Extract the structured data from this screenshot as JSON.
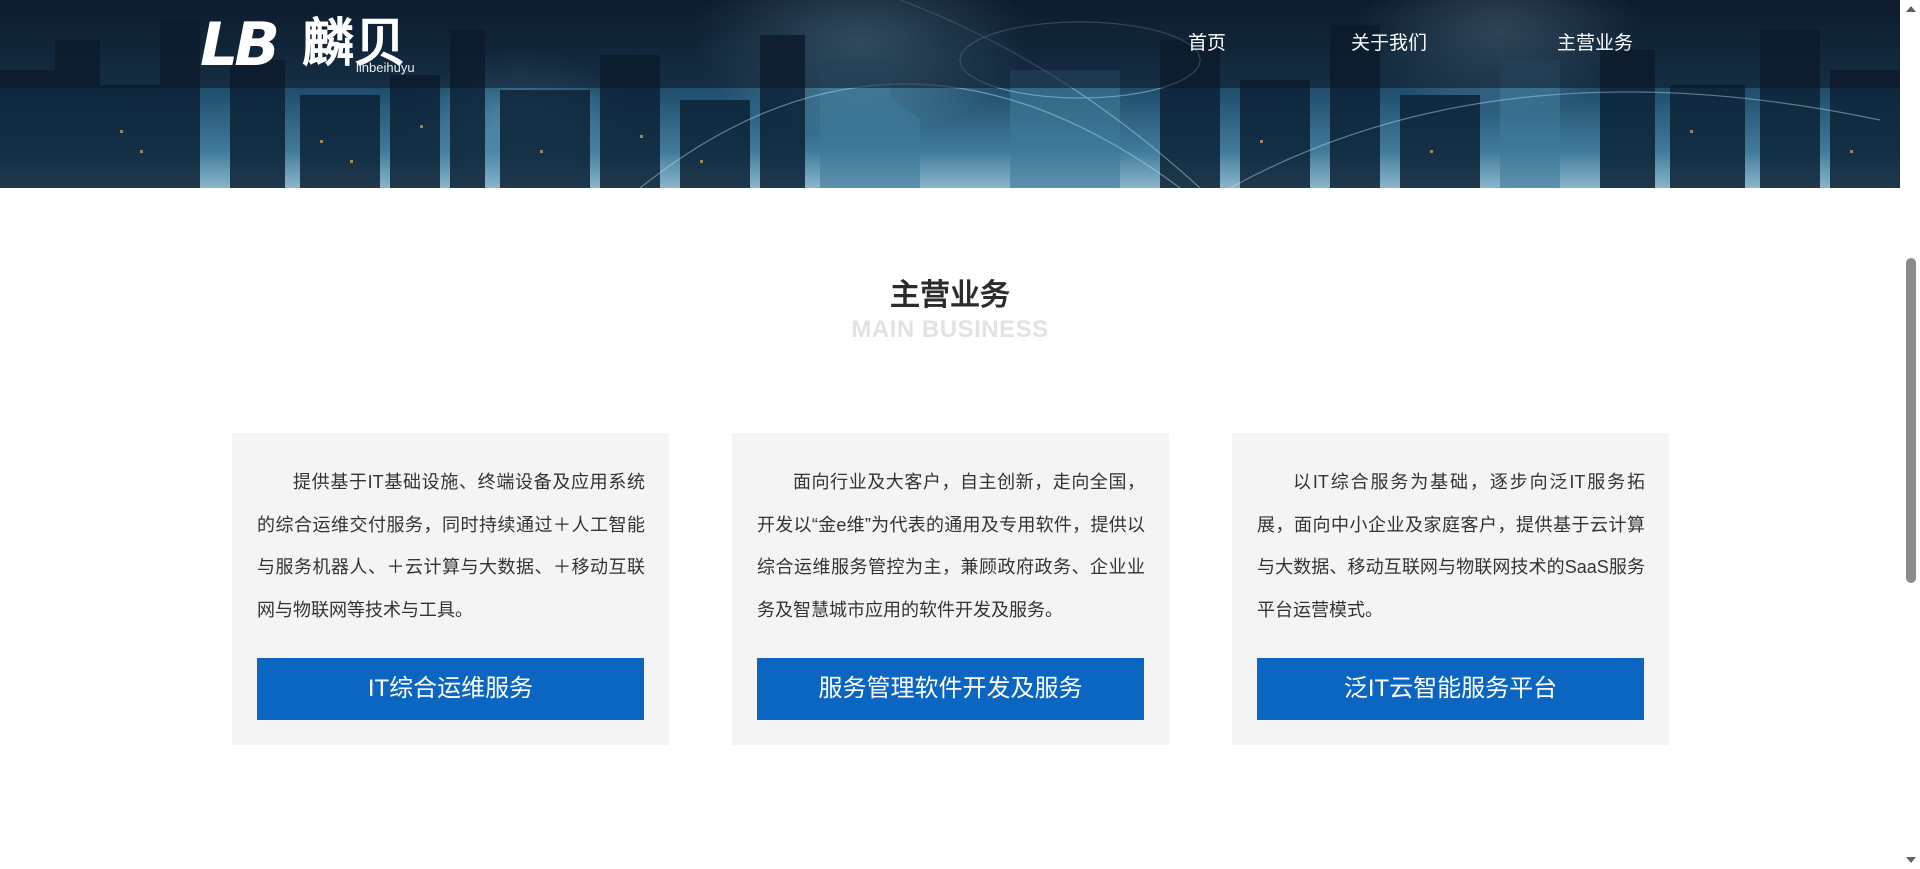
{
  "header": {
    "logo_letters": "LB",
    "logo_chinese": "麟贝",
    "logo_subtitle": "linbeihuyu",
    "nav": [
      {
        "label": "首页"
      },
      {
        "label": "关于我们"
      },
      {
        "label": "主营业务"
      }
    ]
  },
  "section": {
    "title": "主营业务",
    "subtitle": "MAIN BUSINESS"
  },
  "cards": [
    {
      "text": "提供基于IT基础设施、终端设备及应用系统的综合运维交付服务，同时持续通过＋人工智能与服务机器人、＋云计算与大数据、＋移动互联网与物联网等技术与工具。",
      "button": "IT综合运维服务"
    },
    {
      "text": "面向行业及大客户，自主创新，走向全国，开发以“金e维”为代表的通用及专用软件，提供以综合运维服务管控为主，兼顾政府政务、企业业务及智慧城市应用的软件开发及服务。",
      "button": "服务管理软件开发及服务"
    },
    {
      "text": "以IT综合服务为基础，逐步向泛IT服务拓展，面向中小企业及家庭客户，提供基于云计算与大数据、移动互联网与物联网技术的SaaS服务平台运营模式。",
      "button": "泛IT云智能服务平台"
    }
  ],
  "colors": {
    "primary_button": "#0b66c2",
    "card_background": "#f4f4f4",
    "title_text": "#2b2b2b",
    "subtitle_text": "#e2e2e2"
  }
}
